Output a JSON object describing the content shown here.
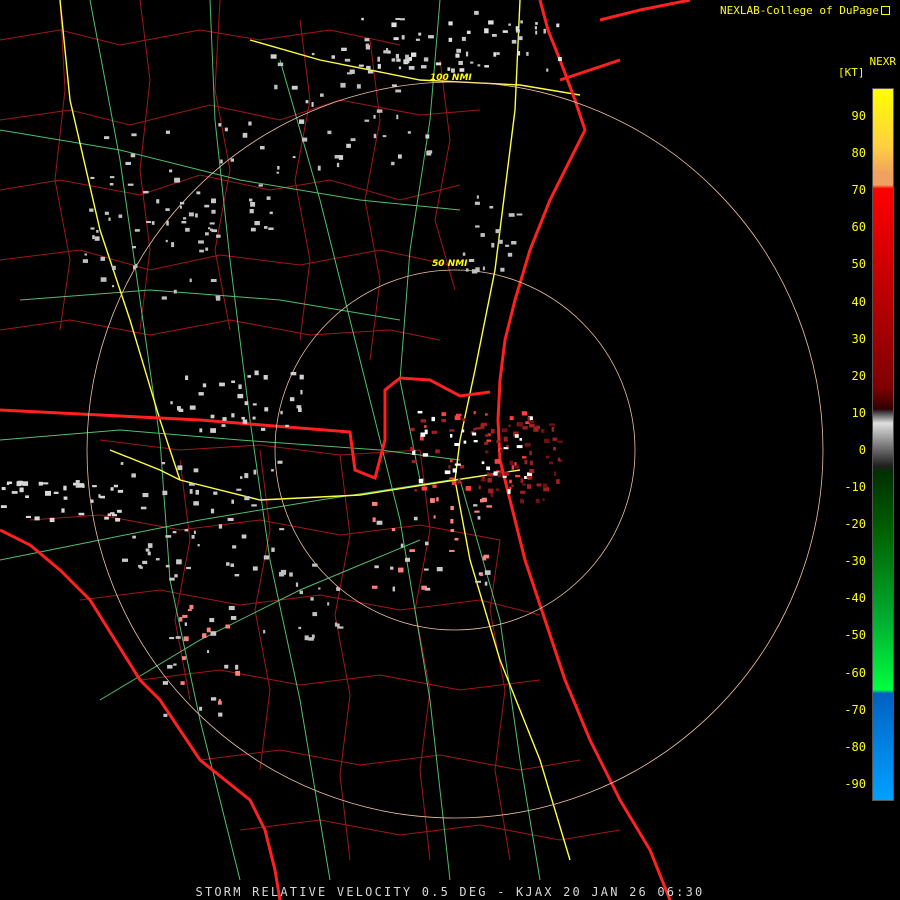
{
  "credit": "NEXLAB-College of DuPage",
  "product_label": "NEXR",
  "unit_label": "[KT]",
  "footer": "STORM RELATIVE VELOCITY 0.5 DEG - KJAX 20 JAN 26 06:30",
  "ring_labels": [
    "100 NMI",
    "50 NMI"
  ],
  "colorbar": {
    "ticks": [
      "90",
      "80",
      "70",
      "60",
      "50",
      "40",
      "30",
      "20",
      "10",
      "0",
      "-10",
      "-20",
      "-30",
      "-40",
      "-50",
      "-60",
      "-70",
      "-80",
      "-90"
    ],
    "colors": {
      "top": "#ffff00",
      "upper": "#f0a060",
      "red": "#ff0000",
      "dark_red": "#800000",
      "neutral": "#808080",
      "dark_green": "#006000",
      "green": "#00ff40",
      "blue": "#0060c0",
      "bottom": "#00a0ff"
    }
  },
  "colors": {
    "coast": "#ff2020",
    "county": "#a01818",
    "state": "#ff2020",
    "road_interstate": "#ffff40",
    "road_highway": "#60e080",
    "range_ring": "#f0c0a0"
  }
}
